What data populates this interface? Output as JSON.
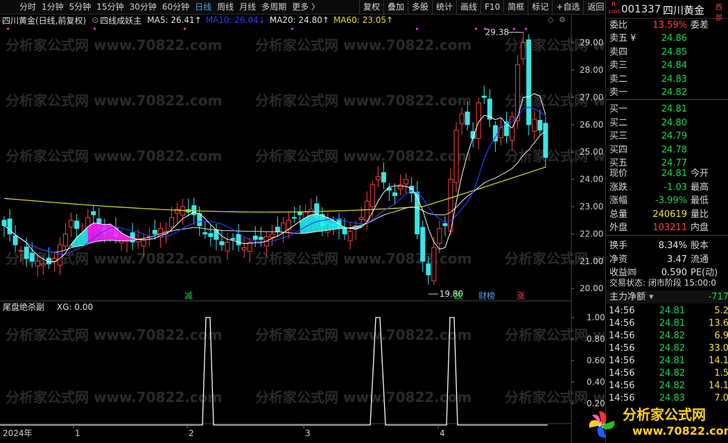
{
  "toolbar": {
    "periods": [
      "分时",
      "1分钟",
      "5分钟",
      "15分钟",
      "30分钟",
      "60分钟",
      "日线",
      "周线",
      "月线",
      "多周期",
      "更多 〉"
    ],
    "active_period": "日线",
    "actions": [
      "复权",
      "叠加",
      "多股",
      "统计",
      "画线",
      "F10",
      "简框",
      "标记",
      "+自选",
      "返回"
    ]
  },
  "legend": {
    "stock": "四川黄金(日线,前复权)",
    "indicator": "四线成妖主",
    "ma5": "MA5: 26.41↑",
    "ma10": "MA10: 26.04↓",
    "ma20": "MA20: 24.80↑",
    "ma60": "MA60: 23.05↑"
  },
  "colors": {
    "up": "#ff4040",
    "down": "#39e6e6",
    "ma5": "#ffffff",
    "ma10": "#2b3bff",
    "ma20": "#e6e6e6",
    "ma60": "#e0e020",
    "fill_cyan": "#20f0f0",
    "fill_magenta": "#ff20ff",
    "green": "#17d84a"
  },
  "watermark": "分析家公式网 www.70822.com",
  "price_axis": {
    "labels": [
      "29.00",
      "28.00",
      "27.00",
      "26.00",
      "25.00",
      "24.00",
      "23.00",
      "22.00",
      "21.00",
      "20.00"
    ],
    "min": 19.6,
    "max": 29.6
  },
  "annotations": {
    "high": "29.38",
    "low": "19.80",
    "marks": [
      "减",
      "跌",
      "财榜",
      "涨"
    ]
  },
  "sub_indicator": {
    "title": "尾盘绝杀副",
    "xg": "XG: 0.00",
    "axis": [
      "1.00",
      "0.80",
      "0.60",
      "0.40",
      "0.20"
    ]
  },
  "time_axis": [
    "2024年",
    "1",
    "2",
    "3",
    "4"
  ],
  "chart_data": {
    "type": "line",
    "series": [
      {
        "name": "XG",
        "x": [
          0,
          1,
          2,
          3
        ],
        "values": [
          1,
          1,
          1,
          1
        ]
      }
    ],
    "candles": {
      "note": "K线"
    },
    "ylim": [
      19.6,
      29.6
    ]
  },
  "quote": {
    "code": "001337",
    "name": "四川黄金",
    "badge_r": "R",
    "badge_num": "1000",
    "corner": "西部",
    "weibi_label": "委比",
    "weibi_val": "13.59%",
    "weicha_label": "委差",
    "sell": [
      {
        "l": "卖五",
        "v": "24.86",
        "mark": "¥"
      },
      {
        "l": "卖四",
        "v": "24.85"
      },
      {
        "l": "卖三",
        "v": "24.84"
      },
      {
        "l": "卖二",
        "v": "24.83"
      },
      {
        "l": "卖一",
        "v": "24.82"
      }
    ],
    "buy": [
      {
        "l": "买一",
        "v": "24.81"
      },
      {
        "l": "买二",
        "v": "24.80"
      },
      {
        "l": "买三",
        "v": "24.79"
      },
      {
        "l": "买四",
        "v": "24.78"
      },
      {
        "l": "买五",
        "v": "24.77"
      }
    ],
    "stats": [
      {
        "l": "现价",
        "v": "24.81",
        "vc": "green",
        "r": "今开"
      },
      {
        "l": "涨跌",
        "v": "-1.03",
        "vc": "green",
        "r": "最高"
      },
      {
        "l": "涨幅",
        "v": "-3.99%",
        "vc": "green",
        "r": "最低"
      },
      {
        "l": "总量",
        "v": "240619",
        "vc": "yellow",
        "r": "量比"
      },
      {
        "l": "外盘",
        "v": "103211",
        "vc": "red",
        "r": "内盘"
      },
      {
        "l": "换手",
        "v": "8.34%",
        "vc": "white",
        "r": "股本"
      },
      {
        "l": "净资",
        "v": "3.47",
        "vc": "white",
        "r": "流通"
      },
      {
        "l": "收益㈣",
        "v": "0.590",
        "vc": "white",
        "r": "PE(动)"
      }
    ],
    "trade_status": "交易状态: 闭市阶段 15:00:0",
    "main_net_label": "主力净额",
    "main_net_val": "-717",
    "ticks": [
      {
        "t": "14:56",
        "p": "24.81",
        "q": "5.2"
      },
      {
        "t": "14:56",
        "p": "24.81",
        "q": "13.6"
      },
      {
        "t": "14:56",
        "p": "24.82",
        "q": "6.9"
      },
      {
        "t": "14:56",
        "p": "24.82",
        "q": "33.0"
      },
      {
        "t": "14:56",
        "p": "24.81",
        "q": "14.1"
      },
      {
        "t": "14:56",
        "p": "24.82",
        "q": "1.5"
      },
      {
        "t": "14:56",
        "p": "24.82",
        "q": "14.1"
      },
      {
        "t": "14:56",
        "p": "24.83",
        "q": "7.0"
      }
    ]
  },
  "logo_text": "分析家公式网",
  "logo_url": "www.70822.com"
}
